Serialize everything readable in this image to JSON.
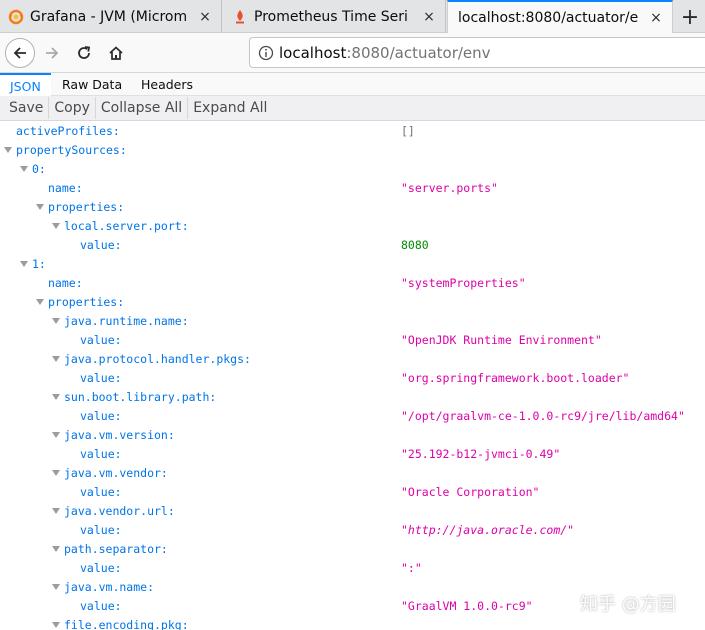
{
  "tabs": [
    {
      "title": "Grafana - JVM (Microm",
      "icon": "grafana-icon",
      "active": false
    },
    {
      "title": "Prometheus Time Seri",
      "icon": "prometheus-icon",
      "active": false
    },
    {
      "title": "localhost:8080/actuator/e",
      "icon": "none",
      "active": true
    }
  ],
  "new_tab_label": "+",
  "close_glyph": "×",
  "url": {
    "host": "localhost",
    "path": ":8080/actuator/env"
  },
  "viewer": {
    "tabs": [
      "JSON",
      "Raw Data",
      "Headers"
    ],
    "selected_tab": "JSON",
    "toolbar": [
      "Save",
      "Copy",
      "Collapse All",
      "Expand All"
    ]
  },
  "colors": {
    "key": "#0074e8",
    "string": "#dd00a9",
    "number": "#058b00",
    "accent": "#0a84ff"
  },
  "tree": [
    {
      "depth": 0,
      "key": "activeProfiles:",
      "value": "[]",
      "type": "arr",
      "expandable": false
    },
    {
      "depth": 0,
      "key": "propertySources:",
      "value": "",
      "type": "",
      "expandable": true
    },
    {
      "depth": 1,
      "key": "0:",
      "value": "",
      "type": "",
      "expandable": true
    },
    {
      "depth": 2,
      "key": "name:",
      "value": "\"server.ports\"",
      "type": "str",
      "expandable": false
    },
    {
      "depth": 2,
      "key": "properties:",
      "value": "",
      "type": "",
      "expandable": true
    },
    {
      "depth": 3,
      "key": "local.server.port:",
      "value": "",
      "type": "",
      "expandable": true
    },
    {
      "depth": 4,
      "key": "value:",
      "value": "8080",
      "type": "num",
      "expandable": false
    },
    {
      "depth": 1,
      "key": "1:",
      "value": "",
      "type": "",
      "expandable": true
    },
    {
      "depth": 2,
      "key": "name:",
      "value": "\"systemProperties\"",
      "type": "str",
      "expandable": false
    },
    {
      "depth": 2,
      "key": "properties:",
      "value": "",
      "type": "",
      "expandable": true
    },
    {
      "depth": 3,
      "key": "java.runtime.name:",
      "value": "",
      "type": "",
      "expandable": true
    },
    {
      "depth": 4,
      "key": "value:",
      "value": "\"OpenJDK Runtime Environment\"",
      "type": "str",
      "expandable": false
    },
    {
      "depth": 3,
      "key": "java.protocol.handler.pkgs:",
      "value": "",
      "type": "",
      "expandable": true
    },
    {
      "depth": 4,
      "key": "value:",
      "value": "\"org.springframework.boot.loader\"",
      "type": "str",
      "expandable": false
    },
    {
      "depth": 3,
      "key": "sun.boot.library.path:",
      "value": "",
      "type": "",
      "expandable": true
    },
    {
      "depth": 4,
      "key": "value:",
      "value": "\"/opt/graalvm-ce-1.0.0-rc9/jre/lib/amd64\"",
      "type": "str",
      "expandable": false
    },
    {
      "depth": 3,
      "key": "java.vm.version:",
      "value": "",
      "type": "",
      "expandable": true
    },
    {
      "depth": 4,
      "key": "value:",
      "value": "\"25.192-b12-jvmci-0.49\"",
      "type": "str",
      "expandable": false
    },
    {
      "depth": 3,
      "key": "java.vm.vendor:",
      "value": "",
      "type": "",
      "expandable": true
    },
    {
      "depth": 4,
      "key": "value:",
      "value": "\"Oracle Corporation\"",
      "type": "str",
      "expandable": false
    },
    {
      "depth": 3,
      "key": "java.vendor.url:",
      "value": "",
      "type": "",
      "expandable": true
    },
    {
      "depth": 4,
      "key": "value:",
      "value": "\"http://java.oracle.com/\"",
      "type": "url",
      "expandable": false
    },
    {
      "depth": 3,
      "key": "path.separator:",
      "value": "",
      "type": "",
      "expandable": true
    },
    {
      "depth": 4,
      "key": "value:",
      "value": "\":\"",
      "type": "str",
      "expandable": false
    },
    {
      "depth": 3,
      "key": "java.vm.name:",
      "value": "",
      "type": "",
      "expandable": true
    },
    {
      "depth": 4,
      "key": "value:",
      "value": "\"GraalVM 1.0.0-rc9\"",
      "type": "str",
      "expandable": false
    },
    {
      "depth": 3,
      "key": "file.encoding.pkg:",
      "value": "",
      "type": "",
      "expandable": true
    }
  ],
  "watermark": "知乎 @方园"
}
